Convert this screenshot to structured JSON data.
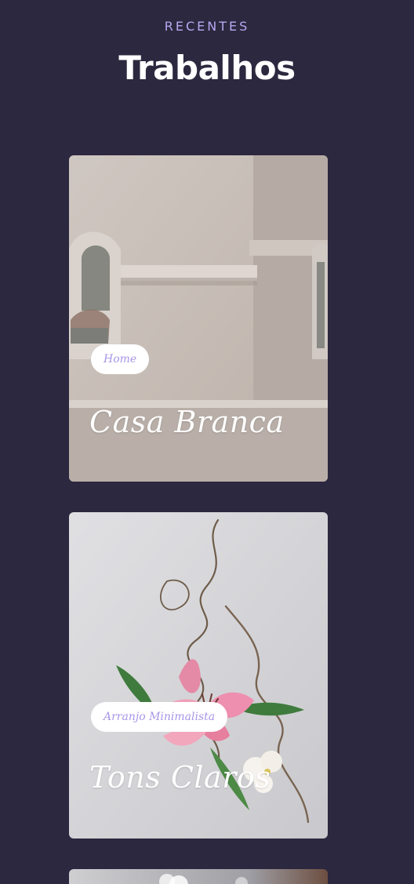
{
  "header": {
    "eyebrow": "RECENTES",
    "title": "Trabalhos"
  },
  "projects": [
    {
      "tag": "Home",
      "title": "Casa Branca",
      "image": "white-house-wall-photo"
    },
    {
      "tag": "Arranjo Minimalista",
      "title": "Tons Claros",
      "image": "pink-lily-arrangement-photo"
    },
    {
      "image": "flowers-photo"
    }
  ],
  "colors": {
    "background": "#2c283f",
    "eyebrow": "#b7a8f0",
    "tag_text": "#a996e8",
    "title_text": "#ffffff"
  }
}
